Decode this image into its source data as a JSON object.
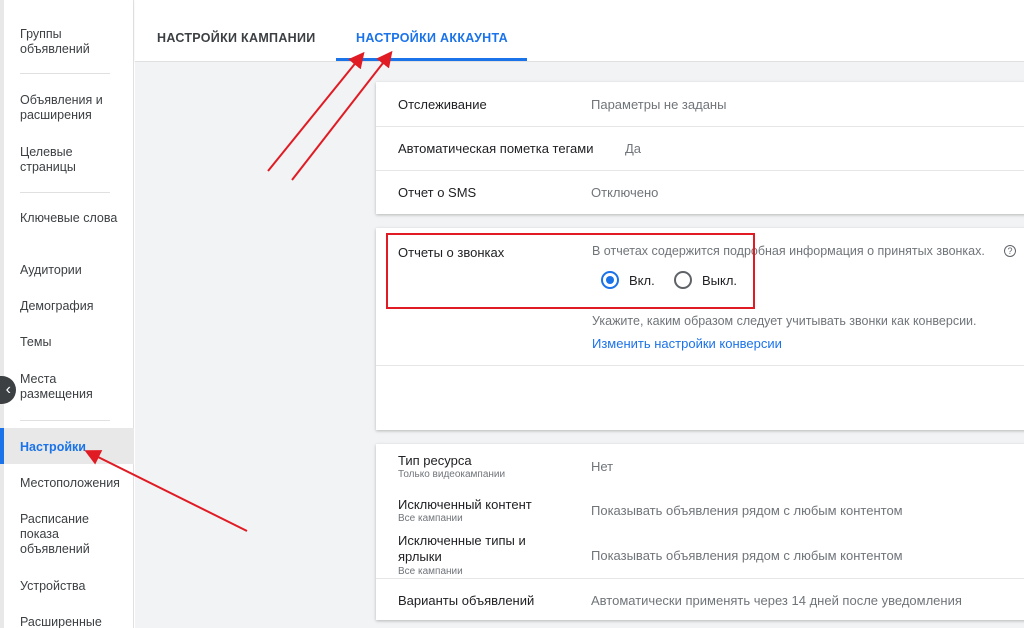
{
  "sidebar": {
    "items": [
      {
        "label": "Группы объявлений"
      },
      {
        "label": "Объявления и расширения"
      },
      {
        "label": "Целевые страницы"
      },
      {
        "label": "Ключевые слова"
      },
      {
        "label": "Аудитории"
      },
      {
        "label": "Демография"
      },
      {
        "label": "Темы"
      },
      {
        "label": "Места размещения"
      },
      {
        "label": "Настройки",
        "active": true
      },
      {
        "label": "Местоположения"
      },
      {
        "label": "Расписание показа объявлений"
      },
      {
        "label": "Устройства"
      },
      {
        "label": "Расширенные"
      }
    ],
    "collapse_icon": "chevron-left-icon"
  },
  "tabs": [
    {
      "label": "НАСТРОЙКИ КАМПАНИИ"
    },
    {
      "label": "НАСТРОЙКИ АККАУНТА",
      "active": true
    }
  ],
  "tracking_card": {
    "rows": [
      {
        "label": "Отслеживание",
        "value": "Параметры не заданы"
      },
      {
        "label": "Автоматическая пометка тегами",
        "value": "Да"
      },
      {
        "label": "Отчет о SMS",
        "value": "Отключено"
      }
    ]
  },
  "call_reports": {
    "label": "Отчеты о звонках",
    "description": "В отчетах содержится подробная информация о принятых звонках.",
    "help_icon": "help-circle-icon",
    "on_label": "Вкл.",
    "off_label": "Выкл.",
    "selected": "on",
    "conversion_hint": "Укажите, каким образом следует учитывать звонки как конверсии.",
    "conversion_link": "Изменить настройки конверсии"
  },
  "content_card": {
    "rows": [
      {
        "label": "Тип ресурса",
        "sublabel": "Только видеокампании",
        "value": "Нет"
      },
      {
        "label": "Исключенный контент",
        "sublabel": "Все кампании",
        "value": "Показывать объявления рядом с любым контентом"
      },
      {
        "label": "Исключенные типы и ярлыки",
        "sublabel": "Все кампании",
        "value": "Показывать объявления рядом с любым контентом"
      },
      {
        "label": "Варианты объявлений",
        "sublabel": "",
        "value": "Автоматически применять через 14 дней после уведомления"
      }
    ]
  },
  "colors": {
    "accent": "#1a73e8",
    "annotation": "#e01b24"
  }
}
